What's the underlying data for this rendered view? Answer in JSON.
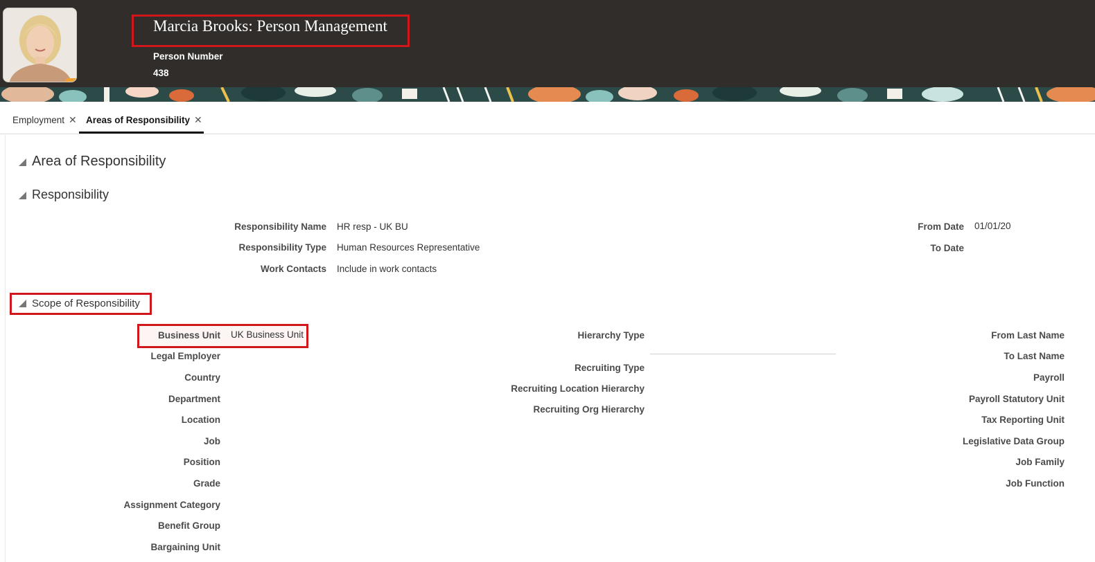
{
  "header": {
    "title": "Marcia Brooks: Person Management",
    "person_number_label": "Person Number",
    "person_number": "438"
  },
  "tabs": [
    {
      "label": "Employment",
      "active": false
    },
    {
      "label": "Areas of Responsibility",
      "active": true
    }
  ],
  "sections": {
    "area": "Area of Responsibility",
    "responsibility": "Responsibility",
    "scope": "Scope of Responsibility"
  },
  "responsibility": {
    "name_label": "Responsibility Name",
    "name_value": "HR resp - UK BU",
    "type_label": "Responsibility Type",
    "type_value": "Human Resources Representative",
    "contacts_label": "Work Contacts",
    "contacts_value": "Include in work contacts",
    "from_label": "From Date",
    "from_value": "01/01/20",
    "to_label": "To Date"
  },
  "scope": {
    "business_unit_label": "Business Unit",
    "business_unit_value": "UK Business Unit",
    "col1": [
      "Legal Employer",
      "Country",
      "Department",
      "Location",
      "Job",
      "Position",
      "Grade",
      "Assignment Category",
      "Benefit Group",
      "Bargaining Unit"
    ],
    "hierarchy_type": "Hierarchy Type",
    "recruiting_type": "Recruiting Type",
    "recruiting_location": "Recruiting Location Hierarchy",
    "recruiting_org": "Recruiting Org Hierarchy",
    "col3": [
      "From Last Name",
      "To Last Name",
      "Payroll",
      "Payroll Statutory Unit",
      "Tax Reporting Unit",
      "Legislative Data Group",
      "Job Family",
      "Job Function"
    ]
  },
  "colors": {
    "header_bg": "#312d2a",
    "highlight_red": "#d0181c"
  }
}
